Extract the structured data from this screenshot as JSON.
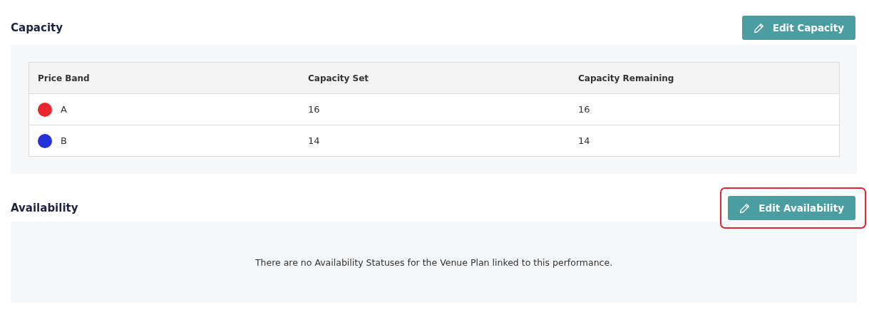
{
  "sections": [
    {
      "kind": "table",
      "title": "Capacity",
      "button": {
        "label": "Edit Capacity",
        "highlighted": false
      },
      "table": {
        "columns": [
          "Price Band",
          "Capacity Set",
          "Capacity Remaining"
        ],
        "rows": [
          {
            "band": "A",
            "color": "#e8262f",
            "capacity_set": "16",
            "capacity_remaining": "16"
          },
          {
            "band": "B",
            "color": "#2432dc",
            "capacity_set": "14",
            "capacity_remaining": "14"
          }
        ]
      }
    },
    {
      "kind": "message",
      "title": "Availability",
      "button": {
        "label": "Edit Availability",
        "highlighted": true
      },
      "message": "There are no Availability Statuses for the Venue Plan linked to this performance."
    }
  ]
}
